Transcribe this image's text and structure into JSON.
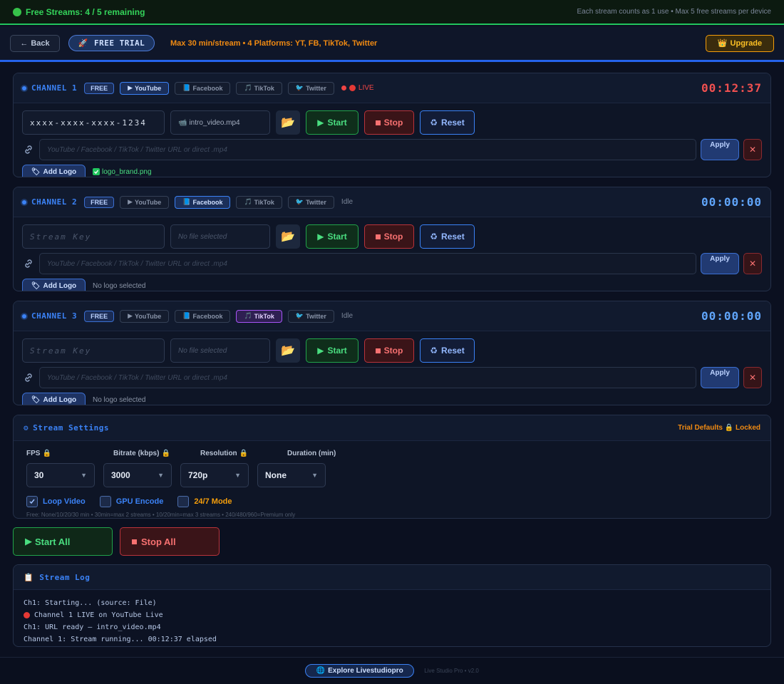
{
  "topbar": {
    "streams_text": "Free Streams: 4 / 5 remaining",
    "note": "Each stream counts as 1 use • Max 5 free streams per device"
  },
  "header": {
    "back_label": "Back",
    "trial_label": "FREE TRIAL",
    "limits_text": "Max 30 min/stream • 4 Platforms: YT, FB, TikTok, Twitter",
    "upgrade_label": "Upgrade"
  },
  "platforms": [
    "YouTube",
    "Facebook",
    "TikTok",
    "Twitter"
  ],
  "channels": [
    {
      "title": "CHANNEL 1",
      "badge": "FREE",
      "active_platform": "YouTube",
      "status": "LIVE",
      "timer": "00:12:37",
      "stream_key": "xxxx-xxxx-xxxx-1234",
      "file": "intro_video.mp4",
      "logo_file": "logo_brand.png"
    },
    {
      "title": "CHANNEL 2",
      "badge": "FREE",
      "active_platform": "Facebook",
      "status": "Idle",
      "timer": "00:00:00",
      "stream_key": "",
      "file": "",
      "logo_file": "No logo selected"
    },
    {
      "title": "CHANNEL 3",
      "badge": "FREE",
      "active_platform": "TikTok",
      "status": "Idle",
      "timer": "00:00:00",
      "stream_key": "",
      "file": "",
      "logo_file": "No logo selected"
    }
  ],
  "channel_ui": {
    "stream_key_placeholder": "Stream Key",
    "file_placeholder": "No file selected",
    "start_label": "Start",
    "stop_label": "Stop",
    "reset_label": "Reset",
    "url_placeholder": "YouTube / Facebook / TikTok / Twitter URL or direct .mp4",
    "apply_label": "Apply",
    "clear_label": "✕",
    "add_logo_label": "Add Logo"
  },
  "settings": {
    "title": "Stream Settings",
    "trial_locked": "Trial Defaults 🔒 Locked",
    "fields": [
      {
        "label": "FPS",
        "locked": true,
        "value": "30"
      },
      {
        "label": "Bitrate (kbps)",
        "locked": true,
        "value": "3000"
      },
      {
        "label": "Resolution",
        "locked": true,
        "value": "720p"
      },
      {
        "label": "Duration (min)",
        "locked": false,
        "value": "None"
      }
    ],
    "checkboxes": [
      {
        "label": "Loop Video",
        "checked": true
      },
      {
        "label": "GPU Encode",
        "checked": false
      },
      {
        "label": "24/7 Mode",
        "checked": false
      }
    ],
    "hint": "Free: None/10/20/30 min • 30min=max 2 streams • 10/20min=max 3 streams • 240/480/960=Premium only"
  },
  "bulk": {
    "start_all": "Start All",
    "stop_all": "Stop All"
  },
  "log": {
    "title": "Stream Log",
    "lines": [
      "Ch1: Starting... (source: File)",
      "Channel 1 LIVE on YouTube Live",
      "Ch1: URL ready — intro_video.mp4",
      "Channel 1: Stream running... 00:12:37 elapsed"
    ]
  },
  "footer": {
    "explore_label": "Explore Livestudiopro",
    "version": "Live Studio Pro • v2.0"
  },
  "colors": {
    "accent": "#3b82f6",
    "success": "#22c55e",
    "danger": "#ef4444",
    "warning": "#f59e0b",
    "background": "#0b1020"
  }
}
